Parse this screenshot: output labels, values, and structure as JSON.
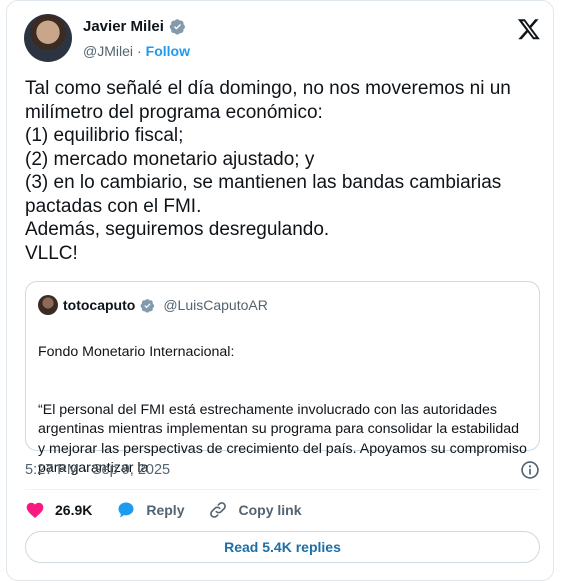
{
  "author": {
    "name": "Javier Milei",
    "handle": "@JMilei",
    "follow_label": "Follow"
  },
  "tweet": {
    "text": "Tal como señalé el día domingo, no nos moveremos ni un milímetro del programa económico:\n(1) equilibrio fiscal;\n(2) mercado monetario ajustado; y\n(3) en lo cambiario, se mantienen las bandas cambiarias pactadas con el FMI.\nAdemás, seguiremos desregulando.\nVLLC!",
    "timestamp": "5:27 PM · Sep 9, 2025"
  },
  "quoted": {
    "name": "totocaputo",
    "handle": "@LuisCaputoAR",
    "line1": "Fondo Monetario Internacional:",
    "line2": "“El personal del FMI está estrechamente involucrado con las autoridades argentinas mientras implementan su programa para consolidar la estabilidad y mejorar las perspectivas de crecimiento del país. Apoyamos su compromiso para garantizar la"
  },
  "actions": {
    "likes": "26.9K",
    "reply_label": "Reply",
    "copy_label": "Copy link"
  },
  "read_replies_label": "Read 5.4K replies",
  "icons": {
    "like": "heart-icon",
    "reply": "speech-bubble-icon",
    "copy": "link-icon",
    "info": "info-icon",
    "logo": "x-logo-icon",
    "verified": "verified-badge-icon"
  },
  "colors": {
    "accent": "#1d9bf0",
    "like": "#f91880",
    "muted": "#536471"
  }
}
